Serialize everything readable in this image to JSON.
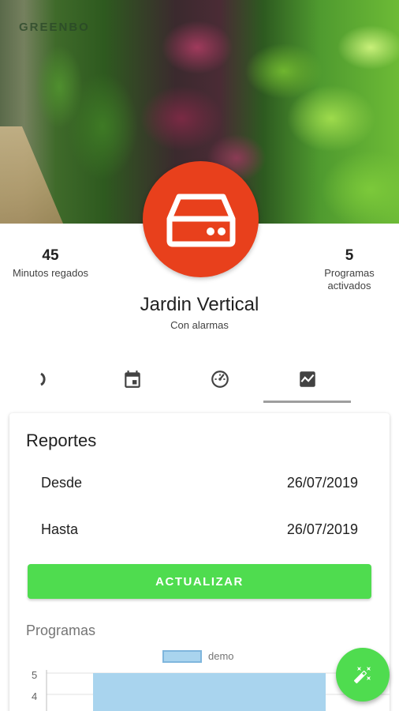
{
  "header": {
    "brand": "GREENBO"
  },
  "stats": {
    "left": {
      "value": "45",
      "label": "Minutos regados"
    },
    "right": {
      "value": "5",
      "label_line1": "Programas",
      "label_line2": "activados"
    }
  },
  "device": {
    "name": "Jardin Vertical",
    "status": "Con alarmas",
    "icon": "storage-device-icon",
    "color": "#e8401c"
  },
  "tabs": [
    {
      "icon": "partial-tab-icon"
    },
    {
      "icon": "calendar-icon"
    },
    {
      "icon": "gauge-icon"
    },
    {
      "icon": "chart-icon",
      "selected": true
    }
  ],
  "report": {
    "title": "Reportes",
    "from_label": "Desde",
    "from_value": "26/07/2019",
    "to_label": "Hasta",
    "to_value": "26/07/2019",
    "button_label": "ACTUALIZAR",
    "section_label": "Programas"
  },
  "chart_data": {
    "type": "bar",
    "series": [
      {
        "name": "demo",
        "values": [
          5
        ]
      }
    ],
    "y_ticks": [
      "5",
      "4"
    ],
    "bar_color": "#a9d4ee",
    "legend_position": "top-center"
  },
  "fab": {
    "icon": "magic-wand-icon",
    "color": "#4fdc4f"
  }
}
